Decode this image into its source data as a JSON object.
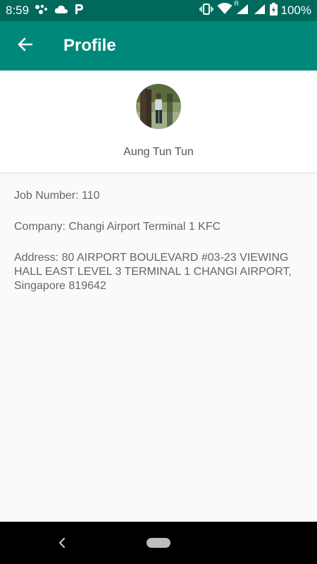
{
  "status_bar": {
    "time": "8:59",
    "battery": "100%",
    "network_badge": "R"
  },
  "app_bar": {
    "title": "Profile"
  },
  "profile": {
    "name": "Aung Tun Tun"
  },
  "details": {
    "job_number": "Job Number: 110",
    "company": "Company: Changi Airport Terminal 1 KFC",
    "address": "Address: 80 AIRPORT BOULEVARD #03-23 VIEWING HALL EAST LEVEL 3 TERMINAL 1 CHANGI AIRPORT, Singapore 819642"
  },
  "colors": {
    "status_bar": "#00695c",
    "app_bar": "#00897b",
    "background": "#fafafa"
  },
  "icons": [
    "assistant-icon",
    "cloud-icon",
    "parking-icon",
    "vibrate-icon",
    "wifi-icon",
    "signal-icon",
    "battery-icon",
    "arrow-back-icon",
    "nav-back-icon",
    "nav-home-icon"
  ]
}
